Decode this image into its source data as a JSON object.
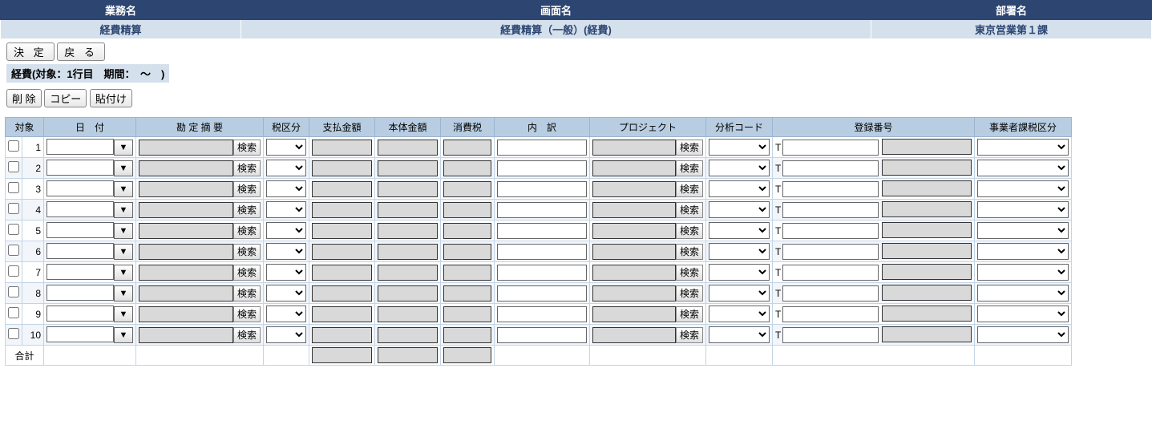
{
  "header": {
    "col1_title": "業務名",
    "col2_title": "画面名",
    "col3_title": "部署名",
    "col1_value": "経費精算",
    "col2_value": "経費精算（一般）(経費)",
    "col3_value": "東京営業第１課"
  },
  "buttons": {
    "decide": "決 定",
    "back": "戻 る",
    "delete": "削 除",
    "copy": "コピー",
    "paste": "貼付け",
    "search": "検索",
    "dropdown": "▼"
  },
  "status_text": "経費(対象：1行目　期間：　～　)",
  "columns": {
    "target": "対象",
    "date": "日　付",
    "summary": "勘 定 摘 要",
    "tax_class": "税区分",
    "pay_amount": "支払金額",
    "body_amount": "本体金額",
    "tax": "消費税",
    "detail": "内　訳",
    "project": "プロジェクト",
    "analysis": "分析コード",
    "reg_no": "登録番号",
    "biz_tax": "事業者課税区分"
  },
  "reg_prefix": "T",
  "total_label": "合計",
  "rows": [
    1,
    2,
    3,
    4,
    5,
    6,
    7,
    8,
    9,
    10
  ]
}
